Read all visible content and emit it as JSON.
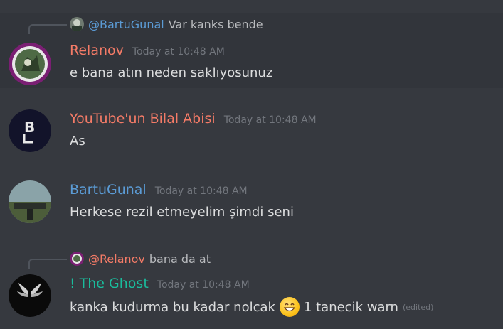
{
  "messages": [
    {
      "reply": {
        "name": "@BartuGunal",
        "text": "Var kanks bende",
        "name_color": "#5b9bd5"
      },
      "author": "Relanov",
      "author_color": "#f47b67",
      "timestamp": "Today at 10:48 AM",
      "content": "e bana atın neden saklıyosunuz"
    },
    {
      "author": "YouTube'un Bilal Abisi",
      "author_color": "#f47b67",
      "timestamp": "Today at 10:48 AM",
      "content": "As"
    },
    {
      "author": "BartuGunal",
      "author_color": "#5b9bd5",
      "timestamp": "Today at 10:48 AM",
      "content": "Herkese rezil etmeyelim şimdi seni"
    },
    {
      "reply": {
        "name": "@Relanov",
        "text": "bana da at",
        "name_color": "#f47b67"
      },
      "author": "! The Ghost",
      "author_color": "#1abc9c",
      "timestamp": "Today at 10:48 AM",
      "content_before": "kanka kudurma bu kadar nolcak",
      "emoji": "grinning-face-emoji",
      "content_after": "1 tanecik warn",
      "edited": "(edited)"
    }
  ],
  "colors": {
    "background": "#36393f",
    "highlight": "#32353b",
    "timestamp": "#72767d"
  }
}
